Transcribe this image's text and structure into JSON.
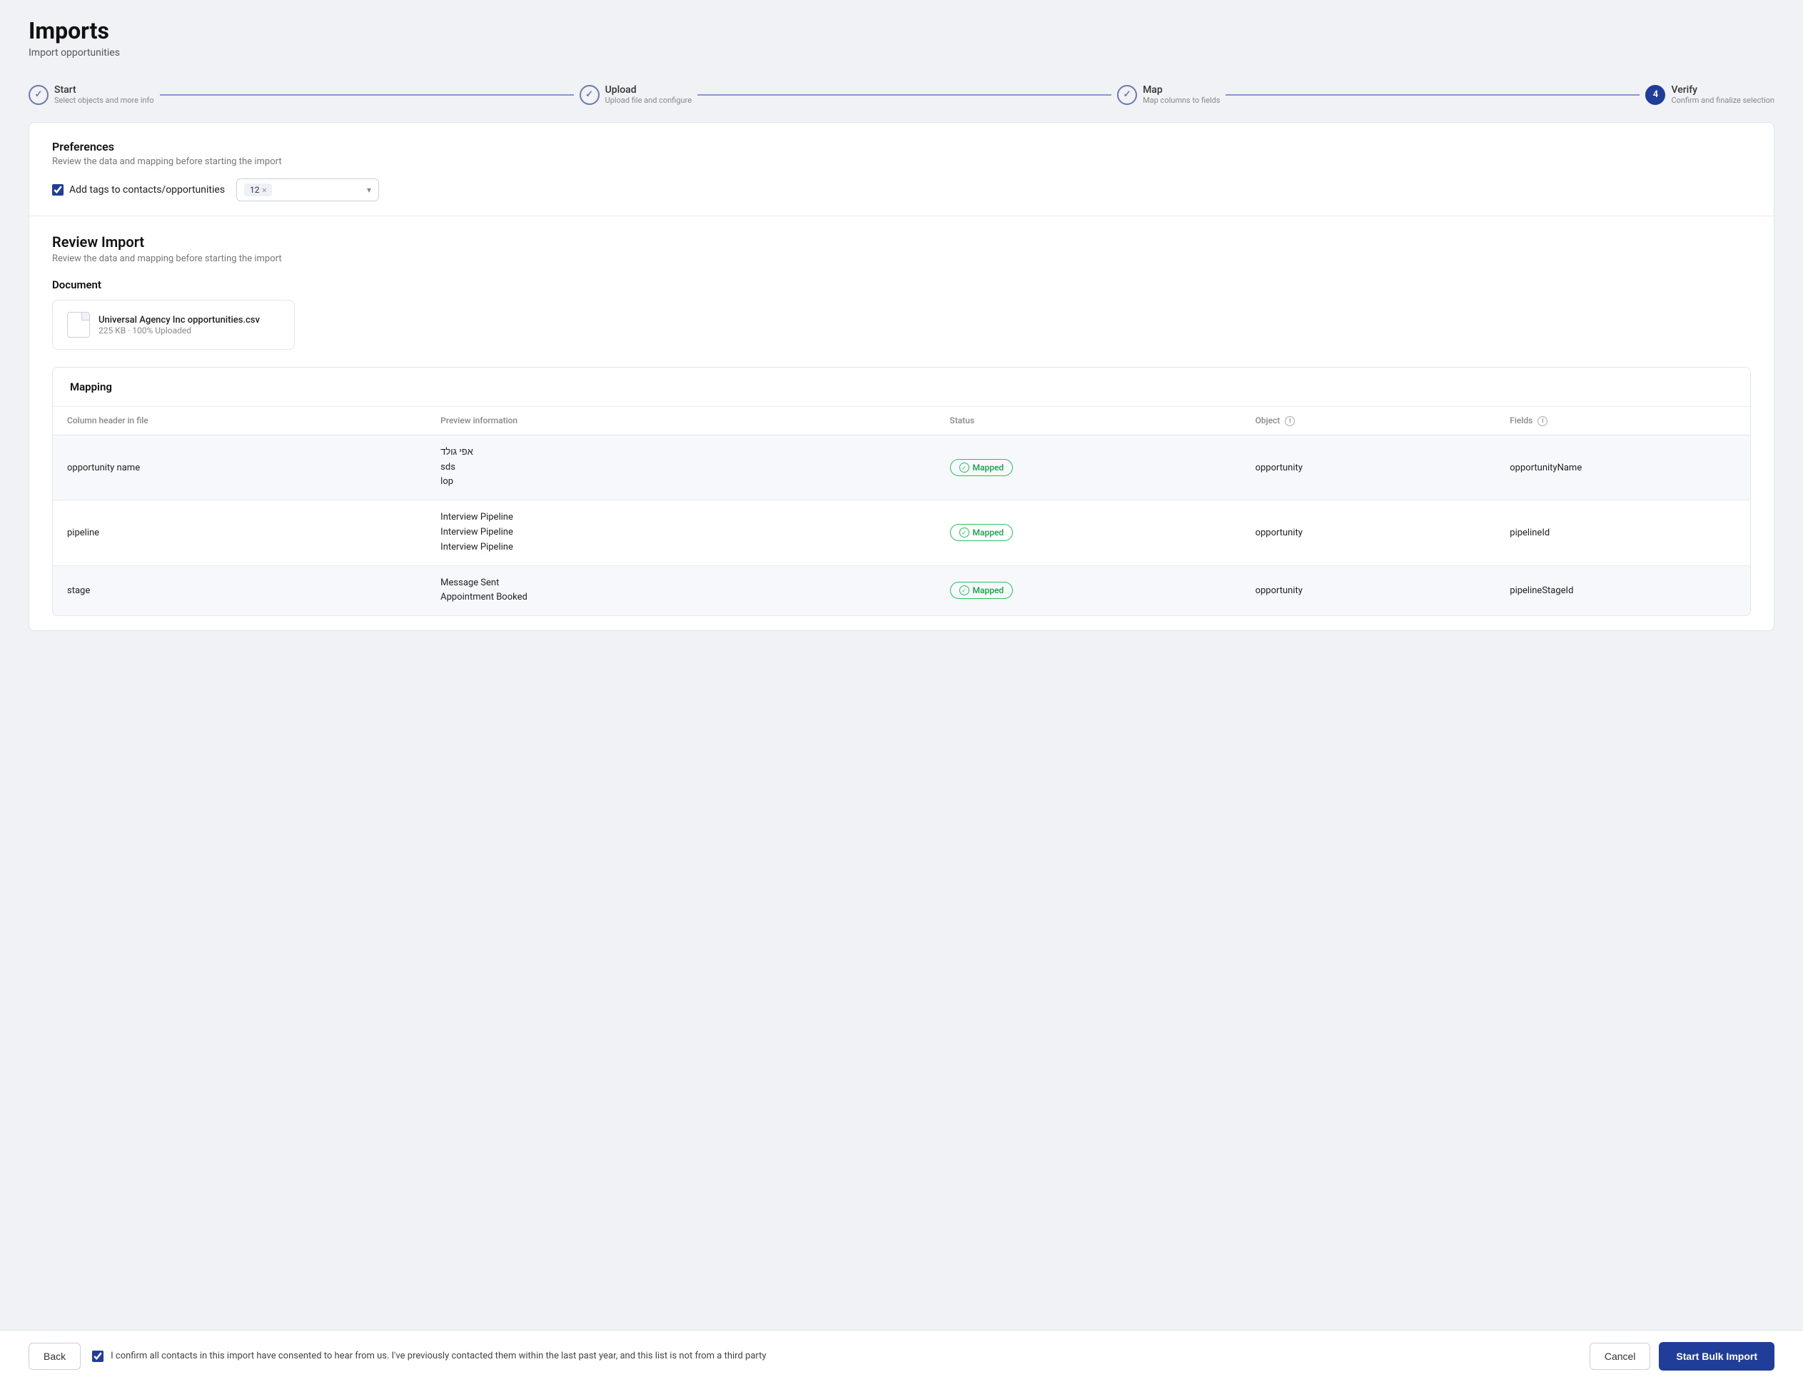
{
  "page": {
    "title": "Imports",
    "subtitle": "Import opportunities"
  },
  "stepper": {
    "steps": [
      {
        "id": "start",
        "number": "✓",
        "label": "Start",
        "desc": "Select objects and more info",
        "state": "completed"
      },
      {
        "id": "upload",
        "number": "✓",
        "label": "Upload",
        "desc": "Upload file and configure",
        "state": "completed"
      },
      {
        "id": "map",
        "number": "✓",
        "label": "Map",
        "desc": "Map columns to fields",
        "state": "completed"
      },
      {
        "id": "verify",
        "number": "4",
        "label": "Verify",
        "desc": "Confirm and finalize selection",
        "state": "active"
      }
    ]
  },
  "preferences": {
    "title": "Preferences",
    "subtitle": "Review the data and mapping before starting the import",
    "checkbox_label": "Add tags to contacts/opportunities",
    "tag_value": "12",
    "tag_x": "×"
  },
  "review": {
    "title": "Review Import",
    "subtitle": "Review the data and mapping before starting the import",
    "document_label": "Document",
    "file": {
      "name": "Universal Agency Inc opportunities.csv",
      "meta": "225 KB · 100% Uploaded"
    }
  },
  "mapping": {
    "title": "Mapping",
    "columns": {
      "header": "Column header in file",
      "preview": "Preview information",
      "status": "Status",
      "object": "Object",
      "fields": "Fields"
    },
    "rows": [
      {
        "column_header": "opportunity name",
        "preview": "אפי גולד\nsds\nlop",
        "status": "Mapped",
        "object": "opportunity",
        "field": "opportunityName"
      },
      {
        "column_header": "pipeline",
        "preview": "Interview Pipeline\nInterview Pipeline\nInterview Pipeline",
        "status": "Mapped",
        "object": "opportunity",
        "field": "pipelineId"
      },
      {
        "column_header": "stage",
        "preview": "Message Sent\nAppointment Booked",
        "status": "Mapped",
        "object": "opportunity",
        "field": "pipelineStageId"
      }
    ]
  },
  "footer": {
    "back_label": "Back",
    "consent_text": "I confirm all contacts in this import have consented to hear from us. I've previously contacted them within the last past year, and this list is not from a third party",
    "cancel_label": "Cancel",
    "start_import_label": "Start Bulk Import"
  }
}
